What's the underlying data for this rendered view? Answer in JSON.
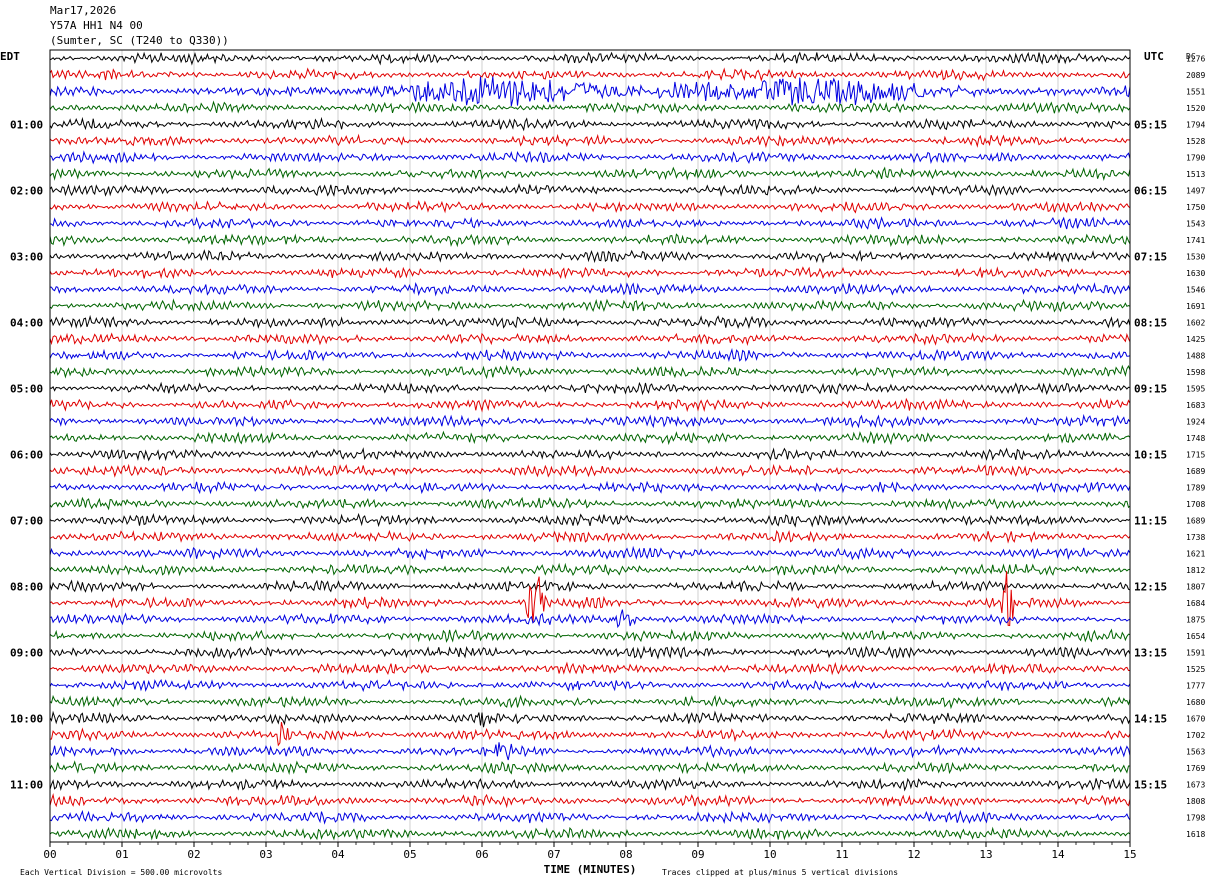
{
  "header": {
    "date": "Mar17,2026",
    "station": "Y57A HH1 N4 00",
    "location": "(Sumter, SC (T240 to Q330))"
  },
  "footer": {
    "scale_note": "Each Vertical Division =  500.00 microvolts",
    "clip_note": "Traces clipped at plus/minus 5 vertical divisions"
  },
  "chart_data": {
    "type": "seismogram",
    "xlabel": "TIME (MINUTES)",
    "x_ticks": [
      "00",
      "01",
      "02",
      "03",
      "04",
      "05",
      "06",
      "07",
      "08",
      "09",
      "10",
      "11",
      "12",
      "13",
      "14",
      "15"
    ],
    "xlim": [
      0,
      15
    ],
    "left_axis_label": "EDT",
    "right_axis_label": "UTC",
    "right_col_header": "DC",
    "trace_colors": [
      "#000000",
      "#e00000",
      "#0000e0",
      "#006400"
    ],
    "edt_hour_labels": [
      "01:00",
      "02:00",
      "03:00",
      "04:00",
      "05:00",
      "06:00",
      "07:00",
      "08:00",
      "09:00",
      "10:00",
      "11:00"
    ],
    "utc_hour_labels": [
      "05:15",
      "06:15",
      "07:15",
      "08:15",
      "09:15",
      "10:15",
      "11:15",
      "12:15",
      "13:15",
      "14:15",
      "15:15"
    ],
    "dc_offsets": [
      1276,
      2089,
      1551,
      1520,
      1794,
      1528,
      1790,
      1513,
      1497,
      1750,
      1543,
      1741,
      1530,
      1630,
      1546,
      1691,
      1602,
      1425,
      1488,
      1598,
      1595,
      1683,
      1924,
      1748,
      1715,
      1689,
      1789,
      1708,
      1689,
      1738,
      1621,
      1812,
      1807,
      1684,
      1875,
      1654,
      1591,
      1525,
      1777,
      1680,
      1670,
      1702,
      1563,
      1769,
      1673,
      1808,
      1798,
      1618
    ],
    "events": [
      {
        "row": 2,
        "start_min": 2.0,
        "end_min": 15.0,
        "label": "teleseism"
      },
      {
        "row": 33,
        "start_min": 6.6,
        "end_min": 6.9,
        "label": "spike"
      },
      {
        "row": 33,
        "start_min": 13.2,
        "end_min": 13.4,
        "label": "spike"
      },
      {
        "row": 34,
        "start_min": 7.7,
        "end_min": 8.2,
        "label": "burst"
      },
      {
        "row": 40,
        "start_min": 5.8,
        "end_min": 6.2,
        "label": "burst"
      },
      {
        "row": 41,
        "start_min": 3.0,
        "end_min": 3.4,
        "label": "burst"
      },
      {
        "row": 42,
        "start_min": 6.1,
        "end_min": 6.5,
        "label": "burst"
      }
    ]
  }
}
